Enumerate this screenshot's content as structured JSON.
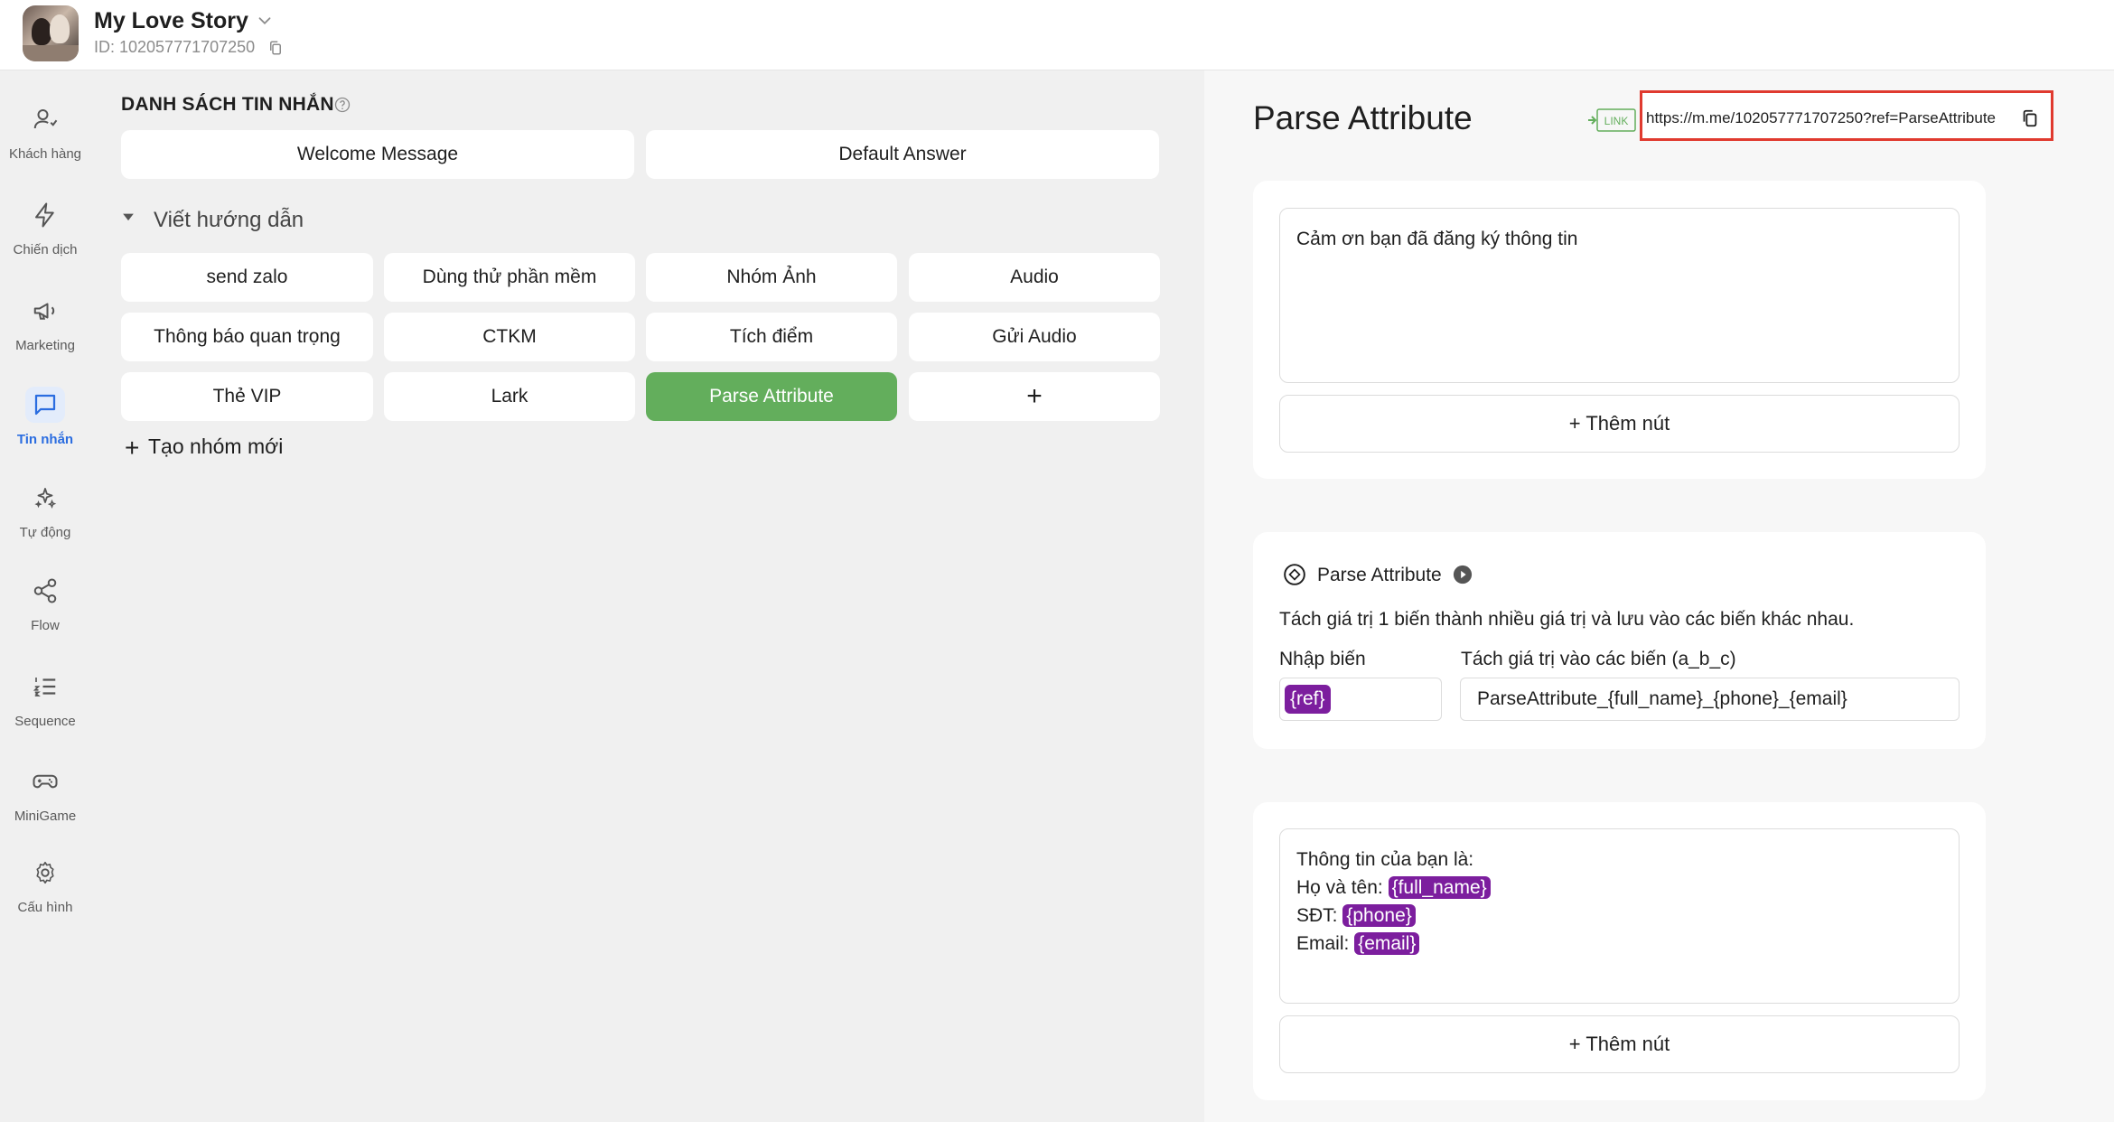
{
  "header": {
    "page_name": "My Love Story",
    "page_id": "ID: 102057771707250"
  },
  "sidebar": {
    "items": [
      {
        "label": "Khách hàng",
        "icon": "user-icon"
      },
      {
        "label": "Chiến dịch",
        "icon": "lightning-icon"
      },
      {
        "label": "Marketing",
        "icon": "megaphone-icon"
      },
      {
        "label": "Tin nhắn",
        "icon": "message-icon",
        "active": true
      },
      {
        "label": "Tự động",
        "icon": "sparkle-icon"
      },
      {
        "label": "Flow",
        "icon": "share-nodes-icon"
      },
      {
        "label": "Sequence",
        "icon": "ordered-list-icon"
      },
      {
        "label": "MiniGame",
        "icon": "gamepad-icon"
      },
      {
        "label": "Cấu hình",
        "icon": "gear-icon"
      }
    ],
    "active_color": "#2b6de0"
  },
  "messages": {
    "title": "DANH SÁCH TIN NHẮN",
    "welcome": "Welcome Message",
    "default_answer": "Default Answer",
    "group_title": "Viết hướng dẫn",
    "items": [
      "send zalo",
      "Dùng thử phần mềm",
      "Nhóm Ảnh",
      "Audio",
      "Thông báo quan trọng",
      "CTKM",
      "Tích điểm",
      "Gửi Audio",
      "Thẻ VIP",
      "Lark",
      "Parse Attribute"
    ],
    "add_item": "+",
    "active_item": "Parse Attribute",
    "active_color": "#63ae5c",
    "new_group": "Tạo nhóm mới"
  },
  "editor": {
    "title": "Parse Attribute",
    "link_badge": "LINK",
    "url": "https://m.me/102057771707250?ref=ParseAttribute",
    "card1": {
      "text": "Cảm ơn bạn đã đăng ký thông tin",
      "add_button": "+ Thêm nút"
    },
    "card2": {
      "title": "Parse Attribute",
      "description": "Tách giá trị 1 biến thành nhiều giá trị và lưu vào các biến khác nhau.",
      "input_label": "Nhập biến",
      "input_value": "{ref}",
      "split_label": "Tách giá trị vào các biến (a_b_c)",
      "split_value": "ParseAttribute_{full_name}_{phone}_{email}"
    },
    "card3": {
      "line1": "Thông tin của bạn là:",
      "line2_prefix": "Họ và tên: ",
      "line2_tag": "{full_name}",
      "line3_prefix": "SĐT: ",
      "line3_tag": "{phone}",
      "line4_prefix": "Email: ",
      "line4_tag": "{email}",
      "add_button": "+ Thêm nút"
    },
    "tag_color": "#7c1e9e",
    "highlight_color": "#e03a2f"
  }
}
